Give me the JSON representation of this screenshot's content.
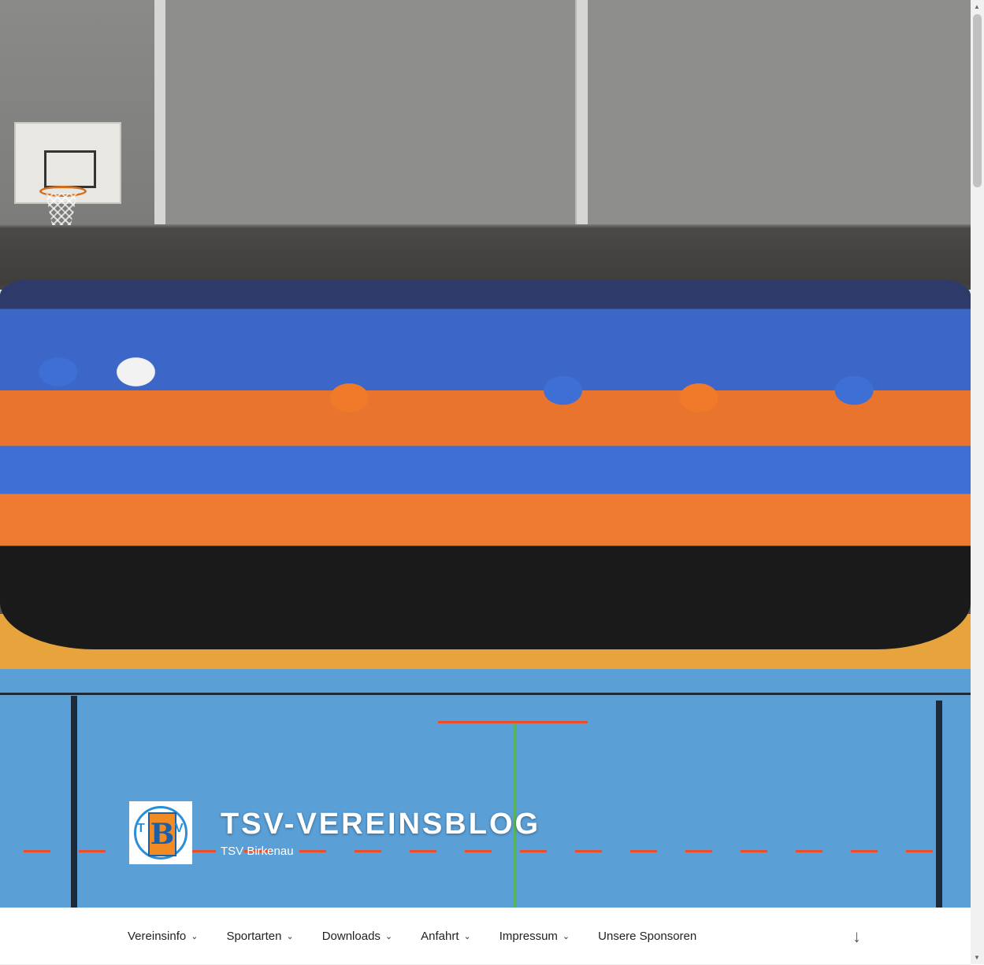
{
  "site": {
    "title": "TSV-VEREINSBLOG",
    "description": "TSV Birkenau",
    "logo_letters": {
      "left": "T",
      "center": "B",
      "right": "V"
    }
  },
  "nav": {
    "items": [
      {
        "label": "Vereinsinfo",
        "has_submenu": true
      },
      {
        "label": "Sportarten",
        "has_submenu": true
      },
      {
        "label": "Downloads",
        "has_submenu": true
      },
      {
        "label": "Anfahrt",
        "has_submenu": true
      },
      {
        "label": "Impressum",
        "has_submenu": true
      },
      {
        "label": "Unsere Sponsoren",
        "has_submenu": false
      }
    ],
    "scroll_icon": "arrow-down-icon"
  },
  "icons": {
    "chevron": "chevron-down-icon"
  },
  "colors": {
    "brand_orange": "#f28b22",
    "brand_blue": "#2a8fd6"
  }
}
